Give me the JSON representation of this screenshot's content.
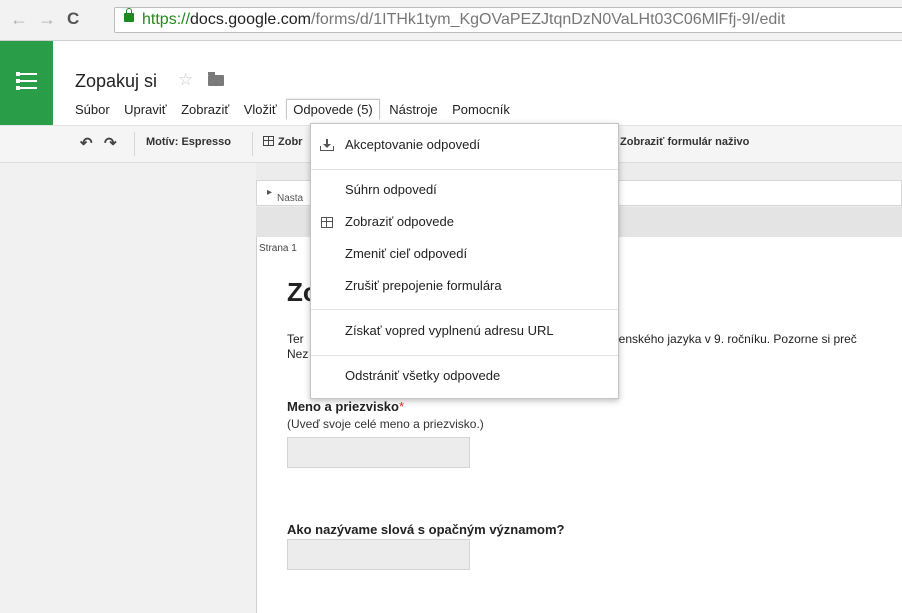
{
  "browser": {
    "back_glyph": "←",
    "forward_glyph": "→",
    "reload_glyph": "C",
    "url_protocol": "https://",
    "url_host": "docs.google.com",
    "url_path": "/forms/d/1ITHk1tym_KgOVaPEZJtqnDzN0VaLHt03C06MlFfj-9I/edit"
  },
  "app": {
    "title": "Zopakuj si",
    "star_glyph": "☆",
    "brand_color": "#2a9d48"
  },
  "menubar": {
    "items": [
      "Súbor",
      "Upraviť",
      "Zobraziť",
      "Vložiť",
      "Odpovede (5)",
      "Nástroje",
      "Pomocník"
    ]
  },
  "toolbar": {
    "undo_glyph": "↶",
    "redo_glyph": "↷",
    "theme_label": "Motív: Espresso",
    "view_responses_partial": "Zobr",
    "live_form_label": "Zobraziť formulár naživo"
  },
  "dropdown": {
    "accept": "Akceptovanie odpovedí",
    "summary": "Súhrn odpovedí",
    "view": "Zobraziť odpovede",
    "change_dest": "Zmeniť cieľ odpovedí",
    "unlink": "Zrušiť prepojenie formulára",
    "prefilled": "Získať vopred vyplnenú adresu URL",
    "delete_all": "Odstrániť všetky odpovede"
  },
  "form": {
    "settings_label": "Nasta",
    "page_label": "Strana 1",
    "title_partial": "Zo",
    "desc_line1_left": "Ter",
    "desc_line1_right": "enského jazyka v 9. ročníku. Pozorne si preč",
    "desc_line2_left": "Nez",
    "q1_title": "Meno a priezvisko",
    "q1_required": "*",
    "q1_help": "(Uveď svoje celé meno a priezvisko.)",
    "q2_title": "Ako nazývame slová s opačným významom?"
  }
}
